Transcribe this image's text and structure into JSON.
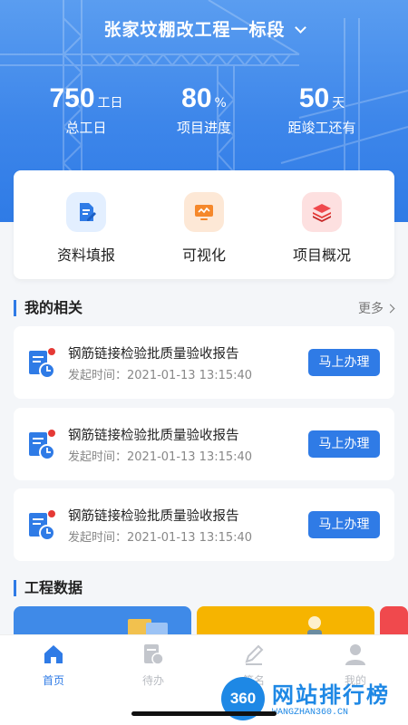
{
  "header": {
    "project_name": "张家坟棚改工程一标段"
  },
  "stats": [
    {
      "value": "750",
      "unit": "工日",
      "label": "总工日"
    },
    {
      "value": "80",
      "unit": "%",
      "label": "项目进度"
    },
    {
      "value": "50",
      "unit": "天",
      "label": "距竣工还有"
    }
  ],
  "quick_actions": [
    {
      "label": "资料填报",
      "icon": "document-edit-icon"
    },
    {
      "label": "可视化",
      "icon": "monitor-icon"
    },
    {
      "label": "项目概况",
      "icon": "layers-icon"
    }
  ],
  "my_related": {
    "title": "我的相关",
    "more_label": "更多",
    "items": [
      {
        "name": "钢筋链接检验批质量验收报告",
        "time": "发起时间：2021-01-13   13:15:40",
        "action": "马上办理"
      },
      {
        "name": "钢筋链接检验批质量验收报告",
        "time": "发起时间：2021-01-13   13:15:40",
        "action": "马上办理"
      },
      {
        "name": "钢筋链接检验批质量验收报告",
        "time": "发起时间：2021-01-13   13:15:40",
        "action": "马上办理"
      }
    ]
  },
  "engineering_data": {
    "title": "工程数据"
  },
  "tabbar": [
    {
      "label": "首页",
      "icon": "home-icon",
      "active": true
    },
    {
      "label": "待办",
      "icon": "todo-icon",
      "active": false
    },
    {
      "label": "签名",
      "icon": "pen-icon",
      "active": false
    },
    {
      "label": "我的",
      "icon": "user-icon",
      "active": false
    }
  ],
  "watermark": {
    "badge": "360",
    "text": "网站排行榜",
    "url": "WANGZHAN360.CN"
  },
  "colors": {
    "primary": "#2f7be6",
    "unread_dot": "#e53935"
  }
}
